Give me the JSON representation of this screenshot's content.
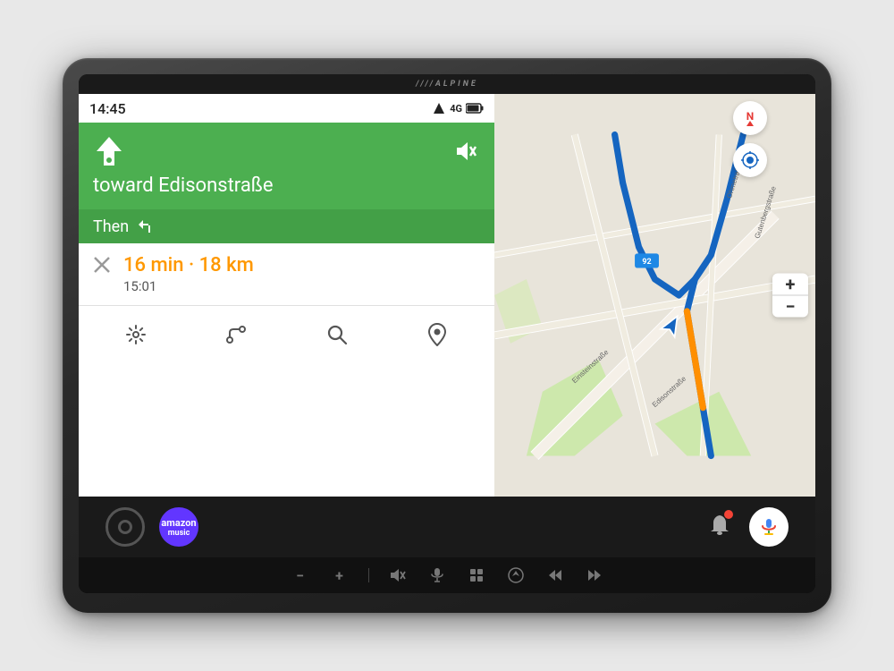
{
  "device": {
    "brand": "////ALPINE"
  },
  "status_bar": {
    "time": "14:45",
    "signal": "4G",
    "battery": "🔋"
  },
  "navigation": {
    "direction": "↑",
    "street": "toward Edisonstraße",
    "then_label": "Then",
    "then_arrow": "↩",
    "eta_text": "16 min · 18 km",
    "arrival_time": "15:01",
    "route_badge": "92"
  },
  "map": {
    "north_label": "N",
    "zoom_plus": "+",
    "zoom_minus": "−",
    "road_labels": [
      "Ohmetraße",
      "Gutenbergstraße",
      "Einsteinstraße",
      "Edisonstraße"
    ]
  },
  "android_bar": {
    "music_label": "music",
    "mic_icon": "🎤"
  },
  "physical_controls": {
    "vol_down": "−",
    "vol_up": "+",
    "mute_star": "🔇★",
    "voice": "🎤",
    "grid": "⊞",
    "circle_arrow": "⊙",
    "prev": "⏮",
    "next": "⏭"
  }
}
